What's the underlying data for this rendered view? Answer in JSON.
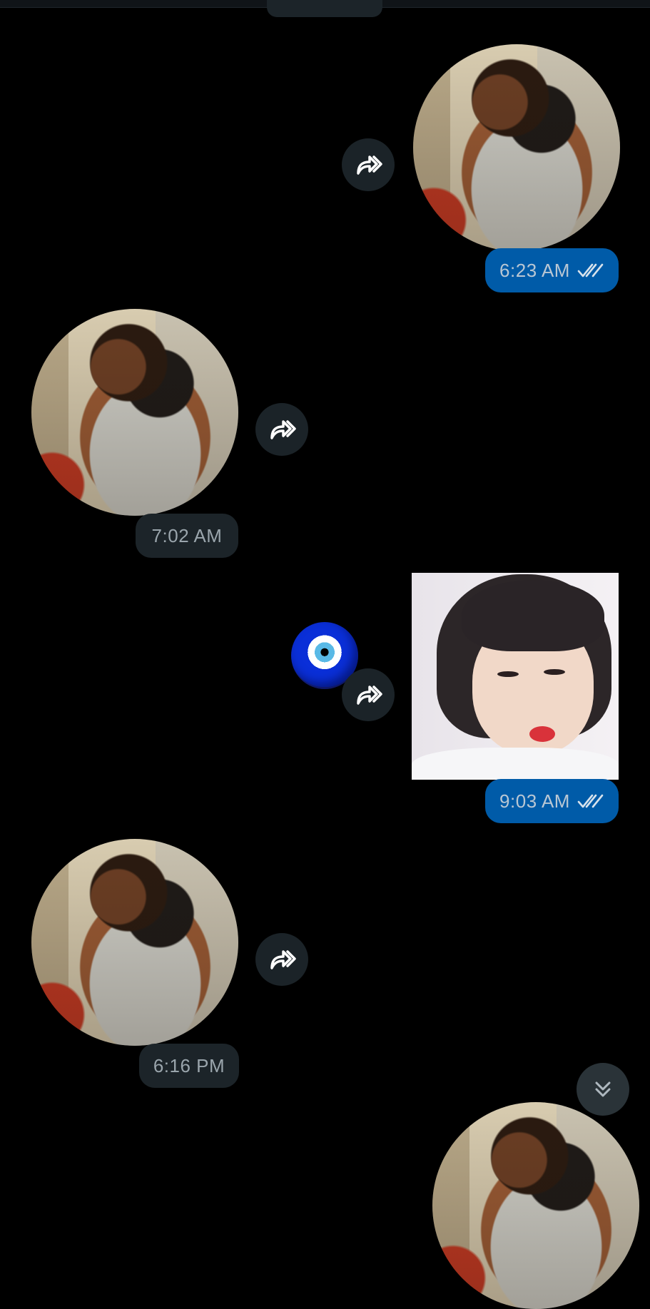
{
  "messages": [
    {
      "direction": "out",
      "type": "video-note",
      "time": "6:23 AM",
      "status": "read"
    },
    {
      "direction": "in",
      "type": "video-note",
      "time": "7:02 AM"
    },
    {
      "direction": "out",
      "type": "sticker",
      "time": "9:03 AM",
      "status": "read",
      "reaction": "nazar-amulet"
    },
    {
      "direction": "in",
      "type": "video-note",
      "time": "6:16 PM"
    },
    {
      "direction": "out",
      "type": "video-note",
      "partial": true
    }
  ],
  "icons": {
    "forward": "forward-icon",
    "read_status": "double-check-icon",
    "scroll_down": "double-chevron-down-icon"
  },
  "colors": {
    "background": "#000000",
    "outgoing_bubble": "#005ba8",
    "incoming_bubble": "#1c2429",
    "forward_button": "#1b2328"
  }
}
